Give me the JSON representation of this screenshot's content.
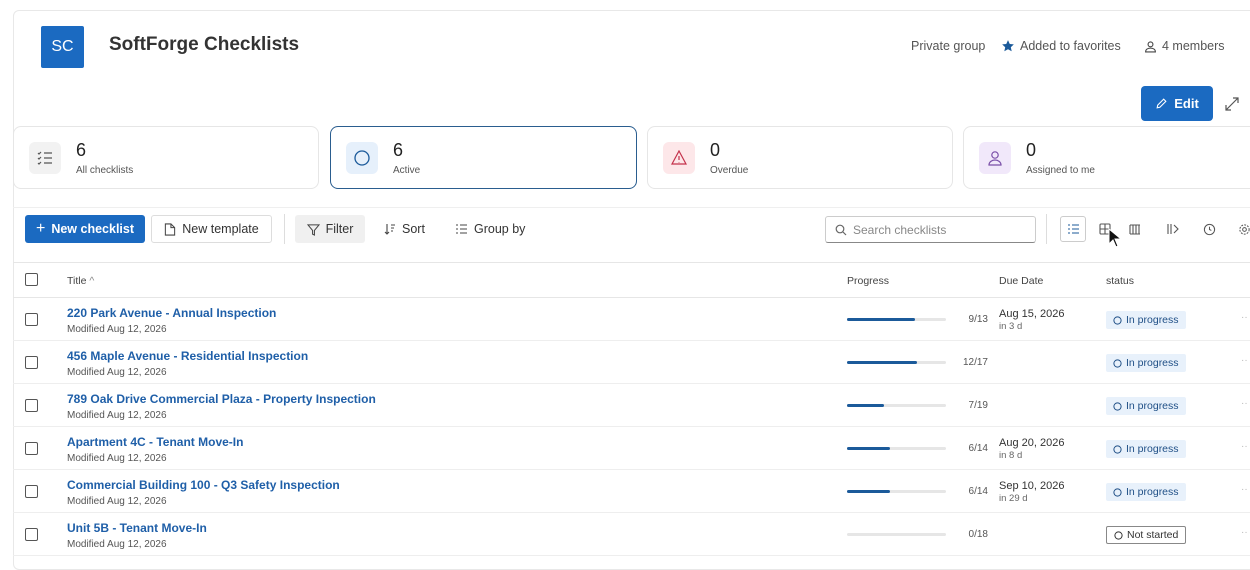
{
  "header": {
    "avatar_initials": "SC",
    "title": "SoftForge Checklists",
    "privacy": "Private group",
    "favorites": "Added to favorites",
    "members": "4 members",
    "edit_label": "Edit"
  },
  "summary_cards": [
    {
      "count": "6",
      "label": "All checklists",
      "icon": "checklist-icon"
    },
    {
      "count": "6",
      "label": "Active",
      "icon": "circle-icon"
    },
    {
      "count": "0",
      "label": "Overdue",
      "icon": "warning-icon"
    },
    {
      "count": "0",
      "label": "Assigned to me",
      "icon": "person-icon"
    }
  ],
  "toolbar": {
    "new_checklist": "New checklist",
    "new_template": "New template",
    "filter": "Filter",
    "sort": "Sort",
    "group_by": "Group by",
    "search_placeholder": "Search checklists"
  },
  "table": {
    "columns": {
      "title": "Title",
      "progress": "Progress",
      "due": "Due Date",
      "status": "status"
    },
    "rows": [
      {
        "title": "220 Park Avenue - Annual Inspection",
        "modified": "Modified Aug 12, 2026",
        "progress": "9/13",
        "progress_fraction": 0.69,
        "due": "Aug 15, 2026",
        "due_rel": "in 3 d",
        "status": "In progress"
      },
      {
        "title": "456 Maple Avenue - Residential Inspection",
        "modified": "Modified Aug 12, 2026",
        "progress": "12/17",
        "progress_fraction": 0.71,
        "due": "",
        "due_rel": "",
        "status": "In progress"
      },
      {
        "title": "789 Oak Drive Commercial Plaza - Property Inspection",
        "modified": "Modified Aug 12, 2026",
        "progress": "7/19",
        "progress_fraction": 0.37,
        "due": "",
        "due_rel": "",
        "status": "In progress"
      },
      {
        "title": "Apartment 4C - Tenant Move-In",
        "modified": "Modified Aug 12, 2026",
        "progress": "6/14",
        "progress_fraction": 0.43,
        "due": "Aug 20, 2026",
        "due_rel": "in 8 d",
        "status": "In progress"
      },
      {
        "title": "Commercial Building 100 - Q3 Safety Inspection",
        "modified": "Modified Aug 12, 2026",
        "progress": "6/14",
        "progress_fraction": 0.43,
        "due": "Sep 10, 2026",
        "due_rel": "in 29 d",
        "status": "In progress"
      },
      {
        "title": "Unit 5B - Tenant Move-In",
        "modified": "Modified Aug 12, 2026",
        "progress": "0/18",
        "progress_fraction": 0,
        "due": "",
        "due_rel": "",
        "status": "Not started"
      }
    ]
  },
  "colors": {
    "brand": "#1b6ac1",
    "link": "#1f5fa8",
    "progress_fill": "#1b5a9a"
  }
}
